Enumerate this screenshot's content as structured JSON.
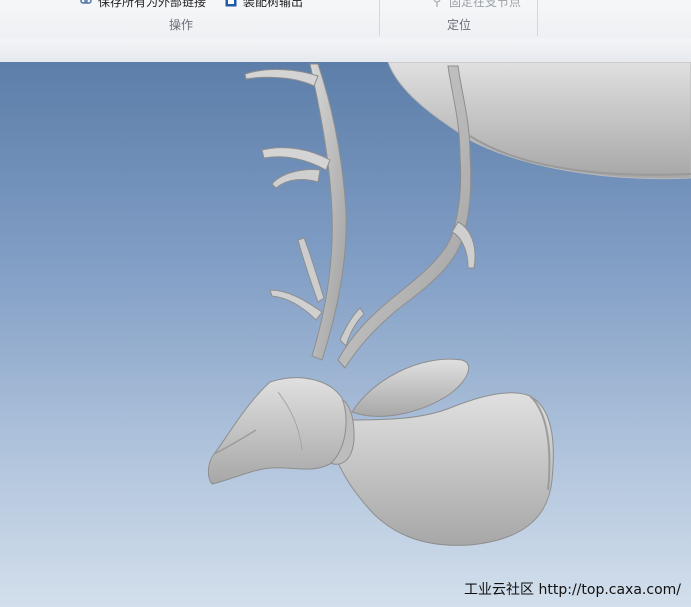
{
  "ribbon": {
    "groups": [
      {
        "label": "操作",
        "commands": [
          {
            "label": "保存所有为外部链接",
            "icon": "chain-icon"
          },
          {
            "label": "装配树输出",
            "icon": "assembly-tree-icon"
          }
        ]
      },
      {
        "label": "定位",
        "commands": [
          {
            "label": "固定在支节点",
            "icon": "pin-icon",
            "disabled": true
          }
        ]
      }
    ]
  },
  "viewport": {
    "model": "deer-head-sculpture",
    "background_top": "#5c7ea8",
    "background_bottom": "#d3dfec",
    "model_color": "#c9c9c9"
  },
  "watermark": {
    "text": "工业云社区 http://top.caxa.com/"
  }
}
